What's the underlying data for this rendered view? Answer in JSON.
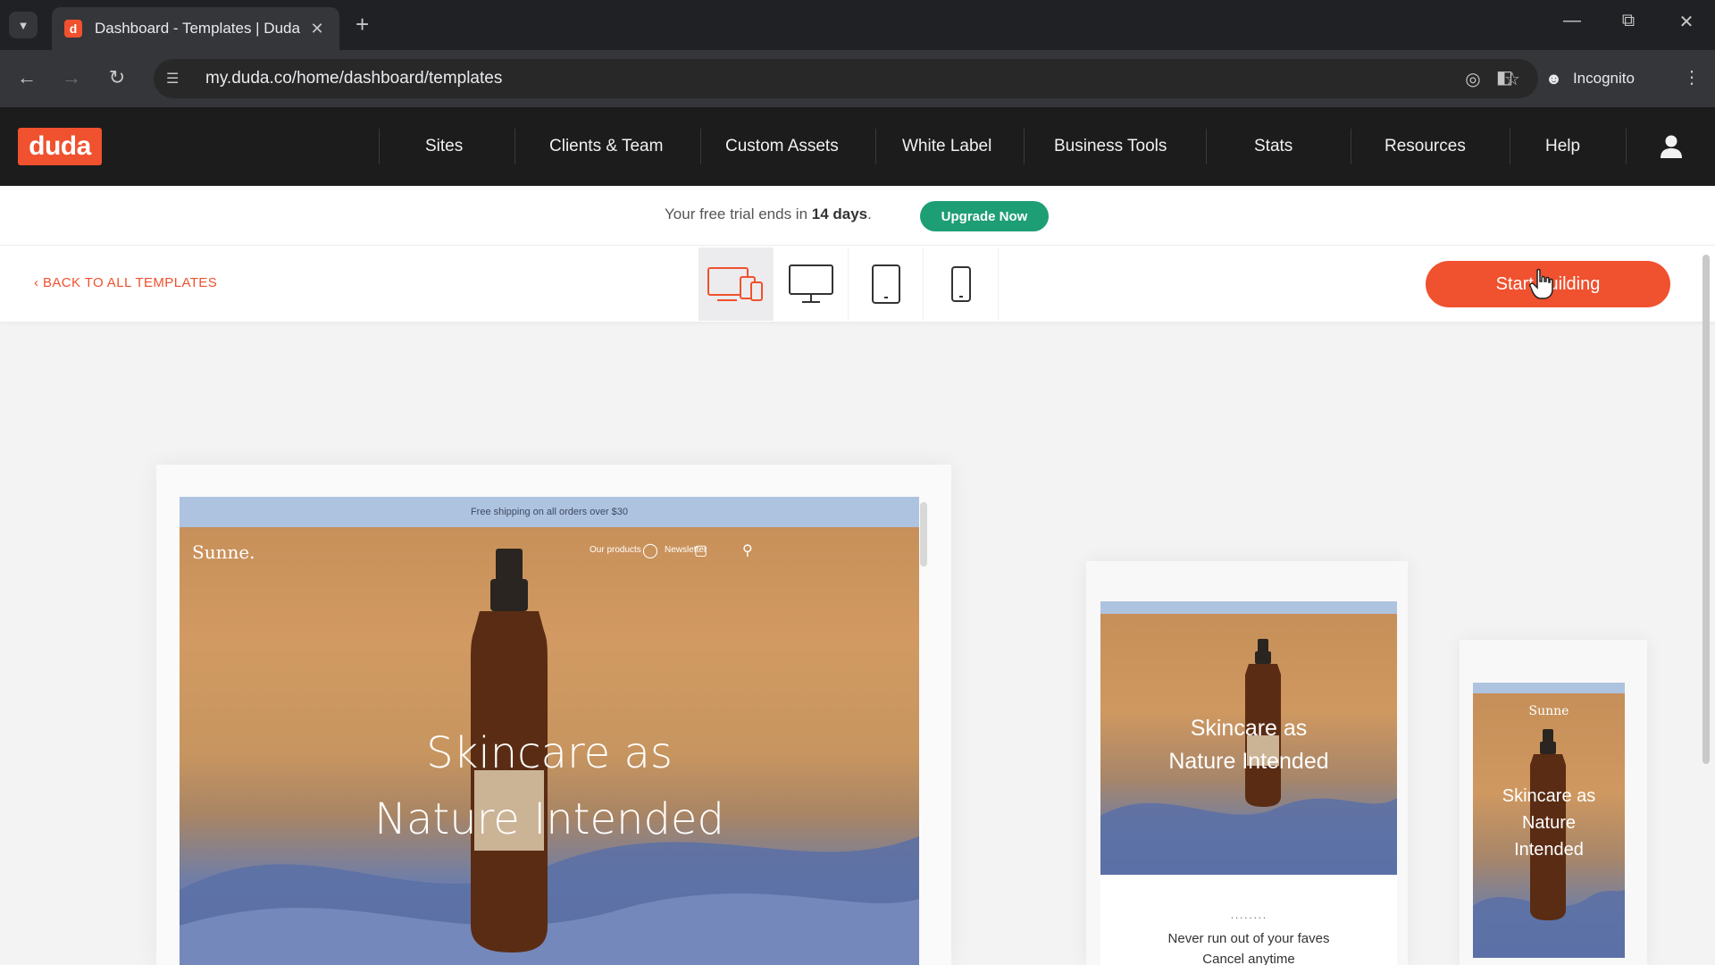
{
  "browser": {
    "tab_title": "Dashboard - Templates | Duda",
    "favicon_letter": "d",
    "url": "my.duda.co/home/dashboard/templates",
    "incognito_label": "Incognito"
  },
  "duda": {
    "logo": "duda",
    "nav": [
      "Sites",
      "Clients & Team",
      "Custom Assets",
      "White Label",
      "Business Tools",
      "Stats",
      "Resources",
      "Help"
    ]
  },
  "trial": {
    "text_prefix": "Your free trial ends in ",
    "days": "14 days",
    "text_suffix": ".",
    "upgrade_label": "Upgrade Now"
  },
  "template_bar": {
    "back_label": "BACK TO ALL TEMPLATES",
    "start_label": "Start building",
    "devices": [
      "all-devices",
      "desktop",
      "tablet",
      "mobile"
    ],
    "active_device": "all-devices"
  },
  "preview": {
    "desktop": {
      "promo": "Free shipping on all orders over $30",
      "brand": "Sunne.",
      "nav": [
        "Our products",
        "Newsletter"
      ],
      "headline_1": "Skincare as",
      "headline_2": "Nature Intended"
    },
    "tablet": {
      "headline_1": "Skincare as",
      "headline_2": "Nature Intended",
      "line_1": "Never run out of your faves",
      "line_2": "Cancel anytime"
    },
    "mobile": {
      "brand": "Sunne",
      "headline_1": "Skincare as",
      "headline_2": "Nature",
      "headline_3": "Intended"
    }
  },
  "colors": {
    "brand": "#f0512e",
    "upgrade": "#1e9e74",
    "header_bg": "#1c1c1d"
  }
}
